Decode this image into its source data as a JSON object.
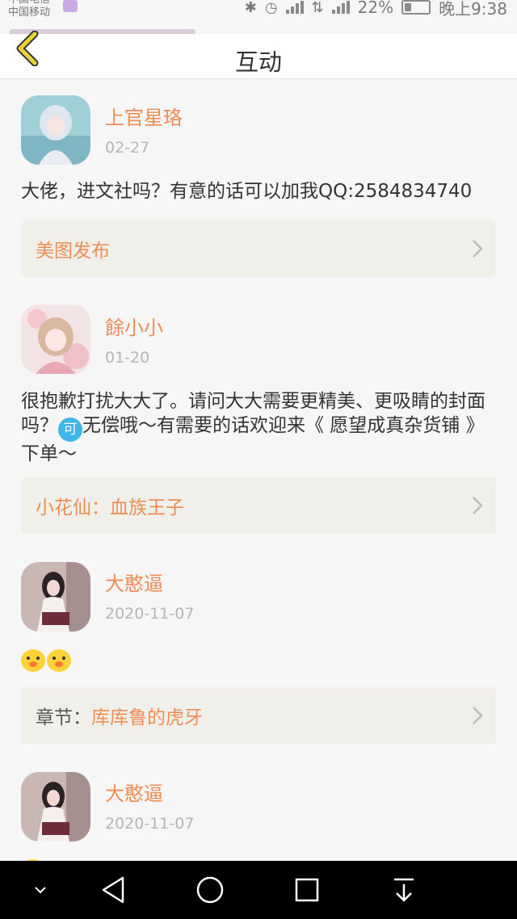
{
  "status_bar": {
    "carrier_line1": "中国电信",
    "carrier_line2": "中国移动",
    "network_label": "46",
    "battery_percent": "22%",
    "time": "晚上9:38"
  },
  "header": {
    "title": "互动",
    "back_icon": "chevron-left-icon"
  },
  "items": [
    {
      "name": "上官星珞",
      "date": "02-27",
      "message": "大佬，进文社吗？有意的话可以加我QQ:2584834740",
      "ref_prefix": "",
      "ref_title": "美图发布"
    },
    {
      "name": "餘小小",
      "date": "01-20",
      "message_part1": "很抱歉打扰大大了。请问大大需要更精美、更吸睛的封面吗？",
      "badge": "可",
      "message_part2": "无偿哦～有需要的话欢迎来《 愿望成真杂货铺 》下单～",
      "ref_prefix": "",
      "ref_title": "小花仙：血族王子"
    },
    {
      "name": "大憨逼",
      "date": "2020-11-07",
      "message_emoji_count": 2,
      "ref_prefix": "章节：",
      "ref_title": "库库鲁的虎牙"
    },
    {
      "name": "大憨逼",
      "date": "2020-11-07"
    }
  ],
  "colors": {
    "accent": "#ef8c56",
    "date_gray": "#b5b5b5",
    "ref_bg": "#f1efe9",
    "back_chevron": "#e8d23a"
  },
  "nav_icons": [
    "chevron-down-icon",
    "back-triangle-icon",
    "home-circle-icon",
    "recents-square-icon",
    "download-icon"
  ]
}
